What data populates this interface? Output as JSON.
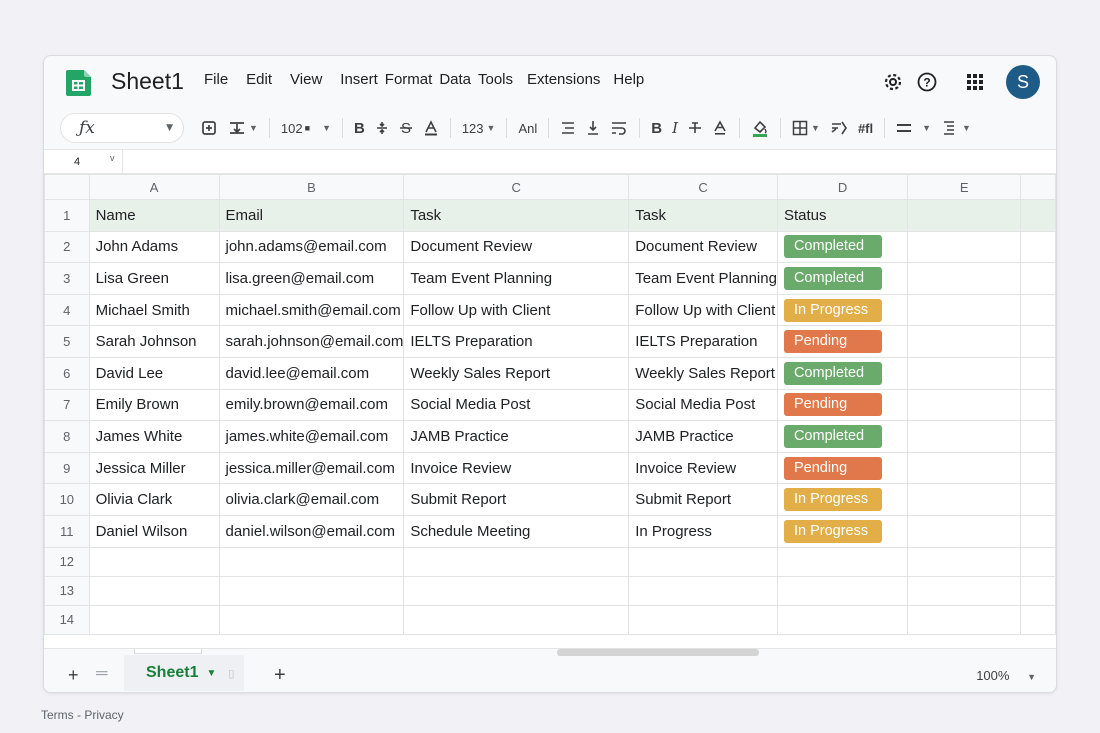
{
  "title": "Sheet1",
  "menu": [
    "File",
    "Edit",
    "View",
    "Insert",
    "Format",
    "Data",
    "Tools",
    "Extensions",
    "Help"
  ],
  "avatar_initial": "S",
  "toolbar": {
    "fx": "ƒx",
    "zoom_value": "102",
    "number_format": "123",
    "text_format": "Anl"
  },
  "name_box": "4",
  "columns": [
    "A",
    "B",
    "C",
    "C",
    "D",
    "E"
  ],
  "rows": [
    {
      "num": "1",
      "name": "Name",
      "email": "Email",
      "task": "Task",
      "task2": "Task",
      "status": "Status",
      "status_color": ""
    },
    {
      "num": "2",
      "name": "John Adams",
      "email": "john.adams@email.com",
      "task": "Document Review",
      "task2": "Document Review",
      "status": "Completed",
      "status_color": "#6aaa6b"
    },
    {
      "num": "3",
      "name": "Lisa Green",
      "email": "lisa.green@email.com",
      "task": "Team Event Planning",
      "task2": "Team Event Planning",
      "status": "Completed",
      "status_color": "#6aaa6b"
    },
    {
      "num": "4",
      "name": "Michael Smith",
      "email": "michael.smith@email.com",
      "task": "Follow Up with Client",
      "task2": "Follow Up with Client",
      "status": "In Progress",
      "status_color": "#e1ae47"
    },
    {
      "num": "5",
      "name": "Sarah Johnson",
      "email": "sarah.johnson@email.com",
      "task": "IELTS Preparation",
      "task2": "IELTS Preparation",
      "status": "Pending",
      "status_color": "#e0784b"
    },
    {
      "num": "6",
      "name": "David Lee",
      "email": "david.lee@email.com",
      "task": "Weekly Sales Report",
      "task2": "Weekly Sales Report",
      "status": "Completed",
      "status_color": "#6aaa6b"
    },
    {
      "num": "7",
      "name": "Emily Brown",
      "email": "emily.brown@email.com",
      "task": "Social Media Post",
      "task2": "Social Media Post",
      "status": "Pending",
      "status_color": "#e0784b"
    },
    {
      "num": "8",
      "name": "James White",
      "email": "james.white@email.com",
      "task": "JAMB Practice",
      "task2": "JAMB Practice",
      "status": "Completed",
      "status_color": "#6aaa6b"
    },
    {
      "num": "9",
      "name": "Jessica Miller",
      "email": "jessica.miller@email.com",
      "task": "Invoice Review",
      "task2": "Invoice Review",
      "status": "Pending",
      "status_color": "#e0784b"
    },
    {
      "num": "10",
      "name": "Olivia Clark",
      "email": "olivia.clark@email.com",
      "task": "Submit Report",
      "task2": "Submit Report",
      "status": "In Progress",
      "status_color": "#e1ae47"
    },
    {
      "num": "11",
      "name": "Daniel Wilson",
      "email": "daniel.wilson@email.com",
      "task": "Schedule Meeting",
      "task2": "In Progress",
      "status": "In Progress",
      "status_color": "#e1ae47"
    }
  ],
  "empty_rows": [
    "12",
    "13",
    "14"
  ],
  "sheet_tab": "Sheet1",
  "zoom_level": "100%",
  "footer": "Terms - Privacy",
  "colors": {
    "accent_green": "#188038",
    "avatar": "#1e5b87",
    "header_fill": "#e8f0ea"
  }
}
